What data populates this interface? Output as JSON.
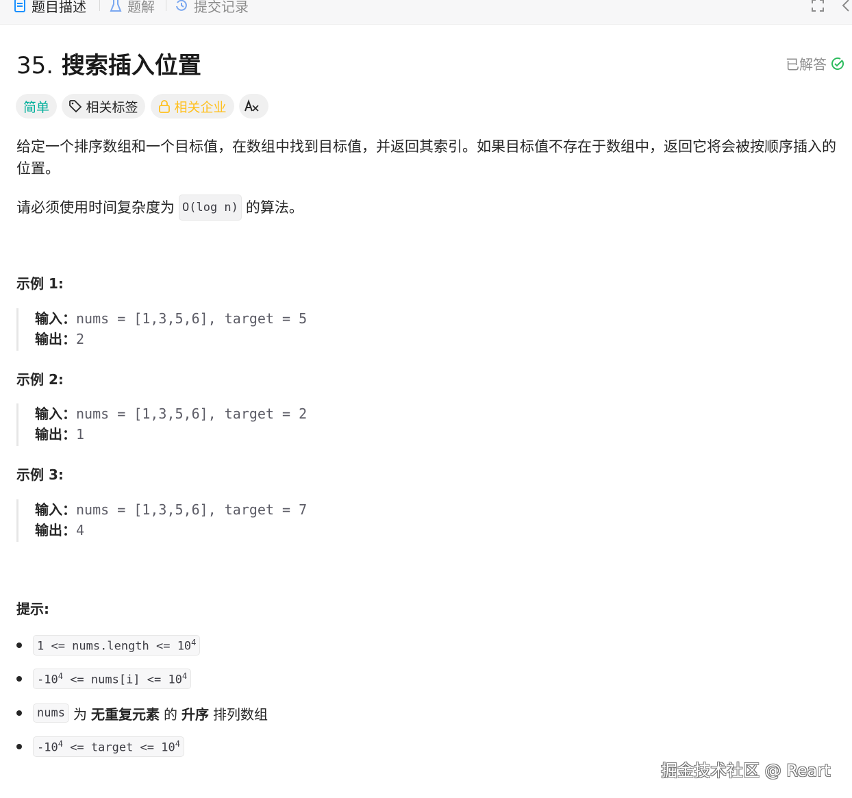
{
  "tabs": [
    {
      "label": "题目描述",
      "active": true
    },
    {
      "label": "题解",
      "active": false
    },
    {
      "label": "提交记录",
      "active": false
    }
  ],
  "problem": {
    "number": "35.",
    "title": "搜索插入位置",
    "status": "已解答"
  },
  "chips": {
    "difficulty": "简单",
    "tags": "相关标签",
    "companies": "相关企业"
  },
  "description": {
    "p1": "给定一个排序数组和一个目标值，在数组中找到目标值，并返回其索引。如果目标值不存在于数组中，返回它将会被按顺序插入的位置。",
    "p2_before": "请必须使用时间复杂度为",
    "p2_code": "O(log n)",
    "p2_after": "的算法。"
  },
  "examples": [
    {
      "title": "示例 1:",
      "input_label": "输入：",
      "input": "nums = [1,3,5,6], target = 5",
      "output_label": "输出：",
      "output": "2"
    },
    {
      "title": "示例 2:",
      "input_label": "输入：",
      "input": "nums = [1,3,5,6], target = 2",
      "output_label": "输出：",
      "output": "1"
    },
    {
      "title": "示例 3:",
      "input_label": "输入：",
      "input": "nums = [1,3,5,6], target = 7",
      "output_label": "输出：",
      "output": "4"
    }
  ],
  "hints": {
    "title": "提示:",
    "h1_code": "1 <= nums.length <= 10",
    "h1_exp": "4",
    "h2_code_a": "-10",
    "h2_exp_a": "4",
    "h2_code_b": " <= nums[i] <= 10",
    "h2_exp_b": "4",
    "h3_code": "nums",
    "h3_t1": "为",
    "h3_b1": "无重复元素",
    "h3_t2": "的",
    "h3_b2": "升序",
    "h3_t3": "排列数组",
    "h4_code_a": "-10",
    "h4_exp_a": "4",
    "h4_code_b": " <= target <= 10",
    "h4_exp_b": "4"
  },
  "watermark": "掘金技术社区 @ Reart",
  "colors": {
    "easy": "#00af9b",
    "companies": "#ffc01e",
    "solved": "#2cbb5d",
    "tab_active_icon": "#1a90ff"
  }
}
